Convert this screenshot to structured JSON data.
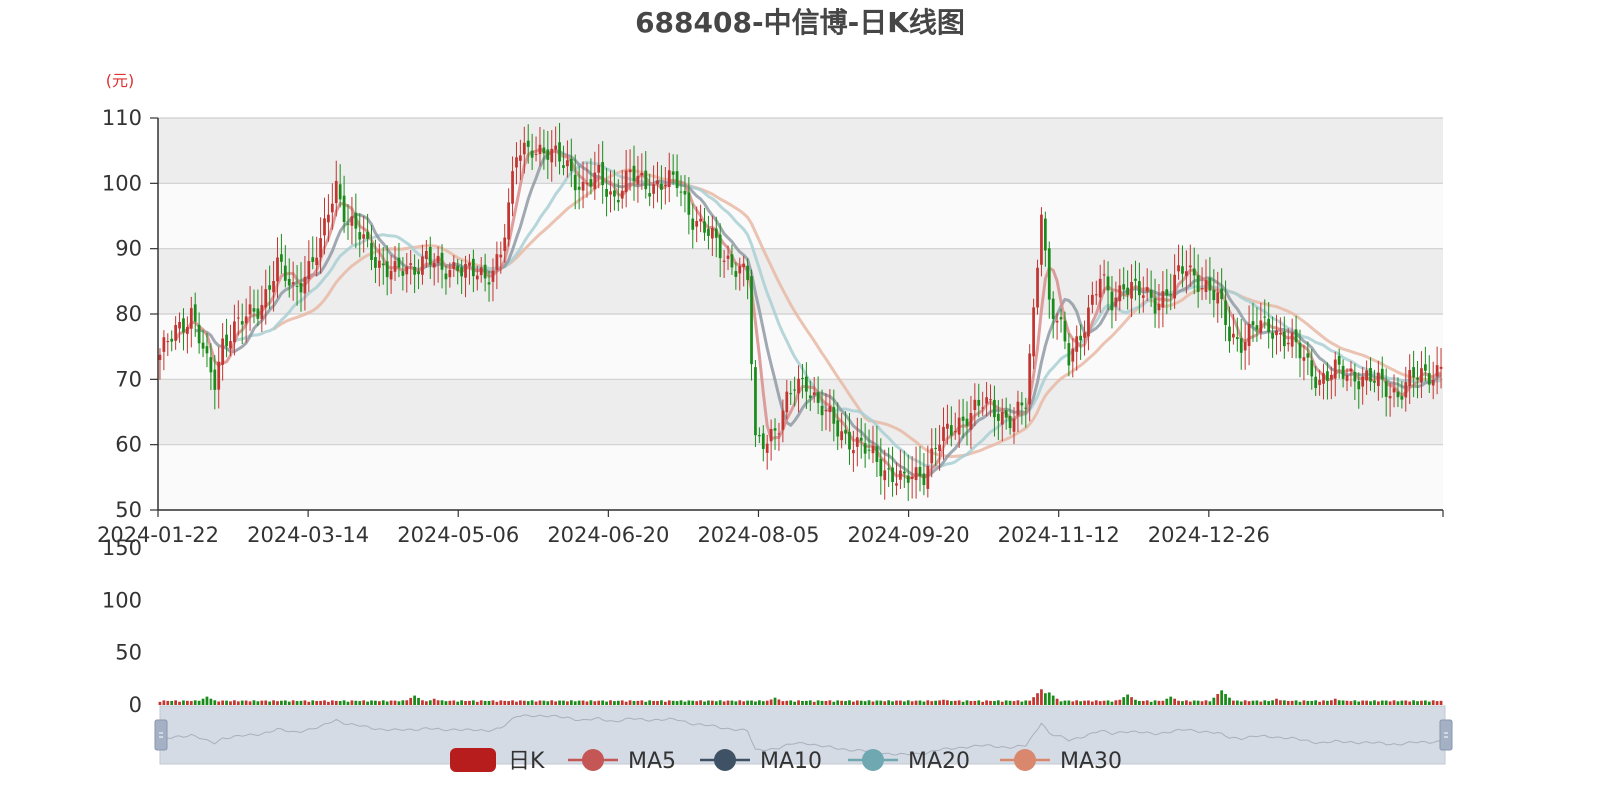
{
  "chart_data": {
    "type": "candlestick",
    "title": "688408-中信博-日K线图",
    "y_unit": "(元)",
    "ylim": [
      50,
      110
    ],
    "yticks": [
      50,
      60,
      70,
      80,
      90,
      100,
      110
    ],
    "x_ticks": [
      "2024-01-22",
      "2024-03-14",
      "2024-05-06",
      "2024-06-20",
      "2024-08-05",
      "2024-09-20",
      "2024-11-12",
      "2024-12-26"
    ],
    "grid": true,
    "legend_position": "bottom",
    "legend": [
      {
        "key": "k",
        "label": "日K",
        "color": "#b81d1d"
      },
      {
        "key": "ma5",
        "label": "MA5",
        "color": "#c45656"
      },
      {
        "key": "ma10",
        "label": "MA10",
        "color": "#3f5265"
      },
      {
        "key": "ma20",
        "label": "MA20",
        "color": "#6fa8b1"
      },
      {
        "key": "ma30",
        "label": "MA30",
        "color": "#d9876d"
      }
    ],
    "colors": {
      "up": "#c23531",
      "down": "#1a8b1a",
      "ma5": "#d98d8d",
      "ma10": "#8f99a3",
      "ma20": "#a9cfd4",
      "ma30": "#e8b8a5"
    },
    "close_anchors": [
      [
        0,
        73
      ],
      [
        4,
        78
      ],
      [
        8,
        80
      ],
      [
        12,
        72
      ],
      [
        14,
        70
      ],
      [
        16,
        76
      ],
      [
        20,
        78
      ],
      [
        26,
        82
      ],
      [
        30,
        87
      ],
      [
        34,
        84
      ],
      [
        38,
        87
      ],
      [
        41,
        90
      ],
      [
        43,
        96
      ],
      [
        45,
        100
      ],
      [
        48,
        94
      ],
      [
        52,
        91
      ],
      [
        56,
        88
      ],
      [
        60,
        86
      ],
      [
        64,
        87
      ],
      [
        68,
        89
      ],
      [
        72,
        86
      ],
      [
        76,
        88
      ],
      [
        80,
        86
      ],
      [
        83,
        85
      ],
      [
        87,
        90
      ],
      [
        89,
        96
      ],
      [
        91,
        104
      ],
      [
        95,
        106
      ],
      [
        100,
        104
      ],
      [
        104,
        103
      ],
      [
        108,
        99
      ],
      [
        112,
        101
      ],
      [
        116,
        98
      ],
      [
        120,
        101
      ],
      [
        124,
        100
      ],
      [
        128,
        100
      ],
      [
        132,
        100
      ],
      [
        136,
        95
      ],
      [
        140,
        92
      ],
      [
        144,
        89
      ],
      [
        148,
        87
      ],
      [
        150,
        85
      ],
      [
        152,
        60
      ],
      [
        154,
        61
      ],
      [
        158,
        63
      ],
      [
        162,
        69
      ],
      [
        165,
        70
      ],
      [
        168,
        66
      ],
      [
        172,
        63
      ],
      [
        176,
        61
      ],
      [
        180,
        59
      ],
      [
        184,
        57
      ],
      [
        188,
        55
      ],
      [
        190,
        54
      ],
      [
        192,
        55
      ],
      [
        195,
        56
      ],
      [
        198,
        60
      ],
      [
        202,
        62
      ],
      [
        206,
        65
      ],
      [
        210,
        66
      ],
      [
        214,
        65
      ],
      [
        218,
        64
      ],
      [
        221,
        66
      ],
      [
        223,
        80
      ],
      [
        225,
        97
      ],
      [
        227,
        82
      ],
      [
        230,
        77
      ],
      [
        232,
        73
      ],
      [
        236,
        79
      ],
      [
        240,
        85
      ],
      [
        243,
        82
      ],
      [
        246,
        85
      ],
      [
        250,
        83
      ],
      [
        254,
        82
      ],
      [
        258,
        84
      ],
      [
        262,
        87
      ],
      [
        266,
        85
      ],
      [
        270,
        82
      ],
      [
        273,
        77
      ],
      [
        276,
        76
      ],
      [
        280,
        78
      ],
      [
        284,
        78
      ],
      [
        288,
        76
      ],
      [
        292,
        73
      ],
      [
        296,
        70
      ],
      [
        300,
        71
      ],
      [
        304,
        71
      ],
      [
        308,
        70
      ],
      [
        312,
        69
      ],
      [
        316,
        68
      ],
      [
        320,
        70
      ],
      [
        324,
        71
      ],
      [
        327,
        72
      ]
    ],
    "volume": {
      "ylim": [
        0,
        150
      ],
      "yticks": [
        0,
        50,
        100,
        150
      ],
      "peaks": [
        [
          12,
          8
        ],
        [
          65,
          9
        ],
        [
          70,
          6
        ],
        [
          157,
          7
        ],
        [
          200,
          5
        ],
        [
          222,
          4
        ],
        [
          225,
          15
        ],
        [
          227,
          12
        ],
        [
          247,
          10
        ],
        [
          258,
          8
        ],
        [
          271,
          14
        ],
        [
          285,
          6
        ],
        [
          300,
          6
        ]
      ],
      "base": 3
    },
    "data_zoom": {
      "start": 0,
      "end": 100
    }
  }
}
